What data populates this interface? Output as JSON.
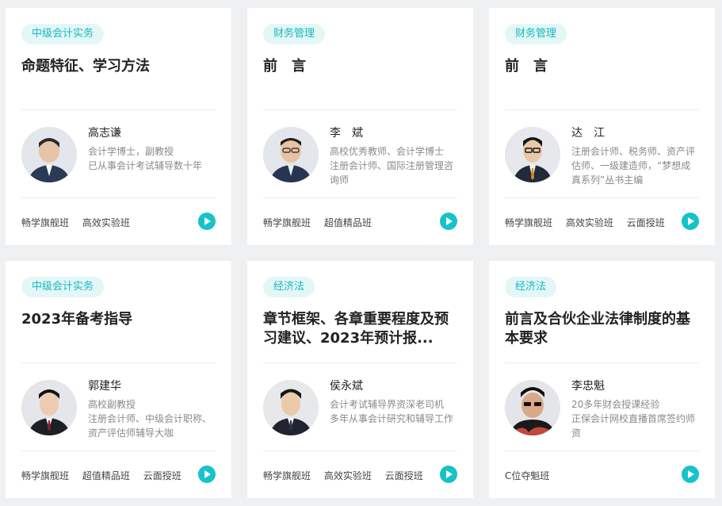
{
  "cards": [
    {
      "tag": "中级会计实务",
      "title": "命题特征、学习方法",
      "teacher": "高志谦",
      "desc": [
        "会计学博士，副教授",
        "已从事会计考试辅导数十年"
      ],
      "classes": [
        "畅学旗舰班",
        "高效实验班"
      ]
    },
    {
      "tag": "财务管理",
      "title": "前　言",
      "teacher": "李　斌",
      "desc": [
        "高校优秀教师、会计学博士",
        "注册会计师、国际注册管理咨",
        "询师"
      ],
      "classes": [
        "畅学旗舰班",
        "超值精品班"
      ]
    },
    {
      "tag": "财务管理",
      "title": "前　言",
      "teacher": "达　江",
      "desc": [
        "注册会计师、税务师、资产评",
        "估师、一级建造师，“梦想成",
        "真系列”丛书主编"
      ],
      "classes": [
        "畅学旗舰班",
        "高效实验班",
        "云面授班"
      ]
    },
    {
      "tag": "中级会计实务",
      "title": "2023年备考指导",
      "teacher": "郭建华",
      "desc": [
        "高校副教授",
        "注册会计师、中级会计职称、",
        "资产评估师辅导大咖"
      ],
      "classes": [
        "畅学旗舰班",
        "超值精品班",
        "云面授班"
      ]
    },
    {
      "tag": "经济法",
      "title": "章节框架、各章重要程度及预习建议、2023年预计报...",
      "teacher": "侯永斌",
      "desc": [
        "会计考试辅导界资深老司机",
        "多年从事会计研究和辅导工作"
      ],
      "classes": [
        "畅学旗舰班",
        "高效实验班",
        "云面授班"
      ]
    },
    {
      "tag": "经济法",
      "title": "前言及合伙企业法律制度的基本要求",
      "teacher": "李忠魁",
      "desc": [
        "20多年财会授课经验",
        "正保会计网校直播首席签约师",
        "资"
      ],
      "classes": [
        "C位夺魁班"
      ]
    }
  ],
  "colors": {
    "accent": "#15c3c9",
    "tag_bg": "#e4f7f7",
    "page_bg": "#eef0f2"
  },
  "icons": {
    "play": "play-circle-icon"
  }
}
